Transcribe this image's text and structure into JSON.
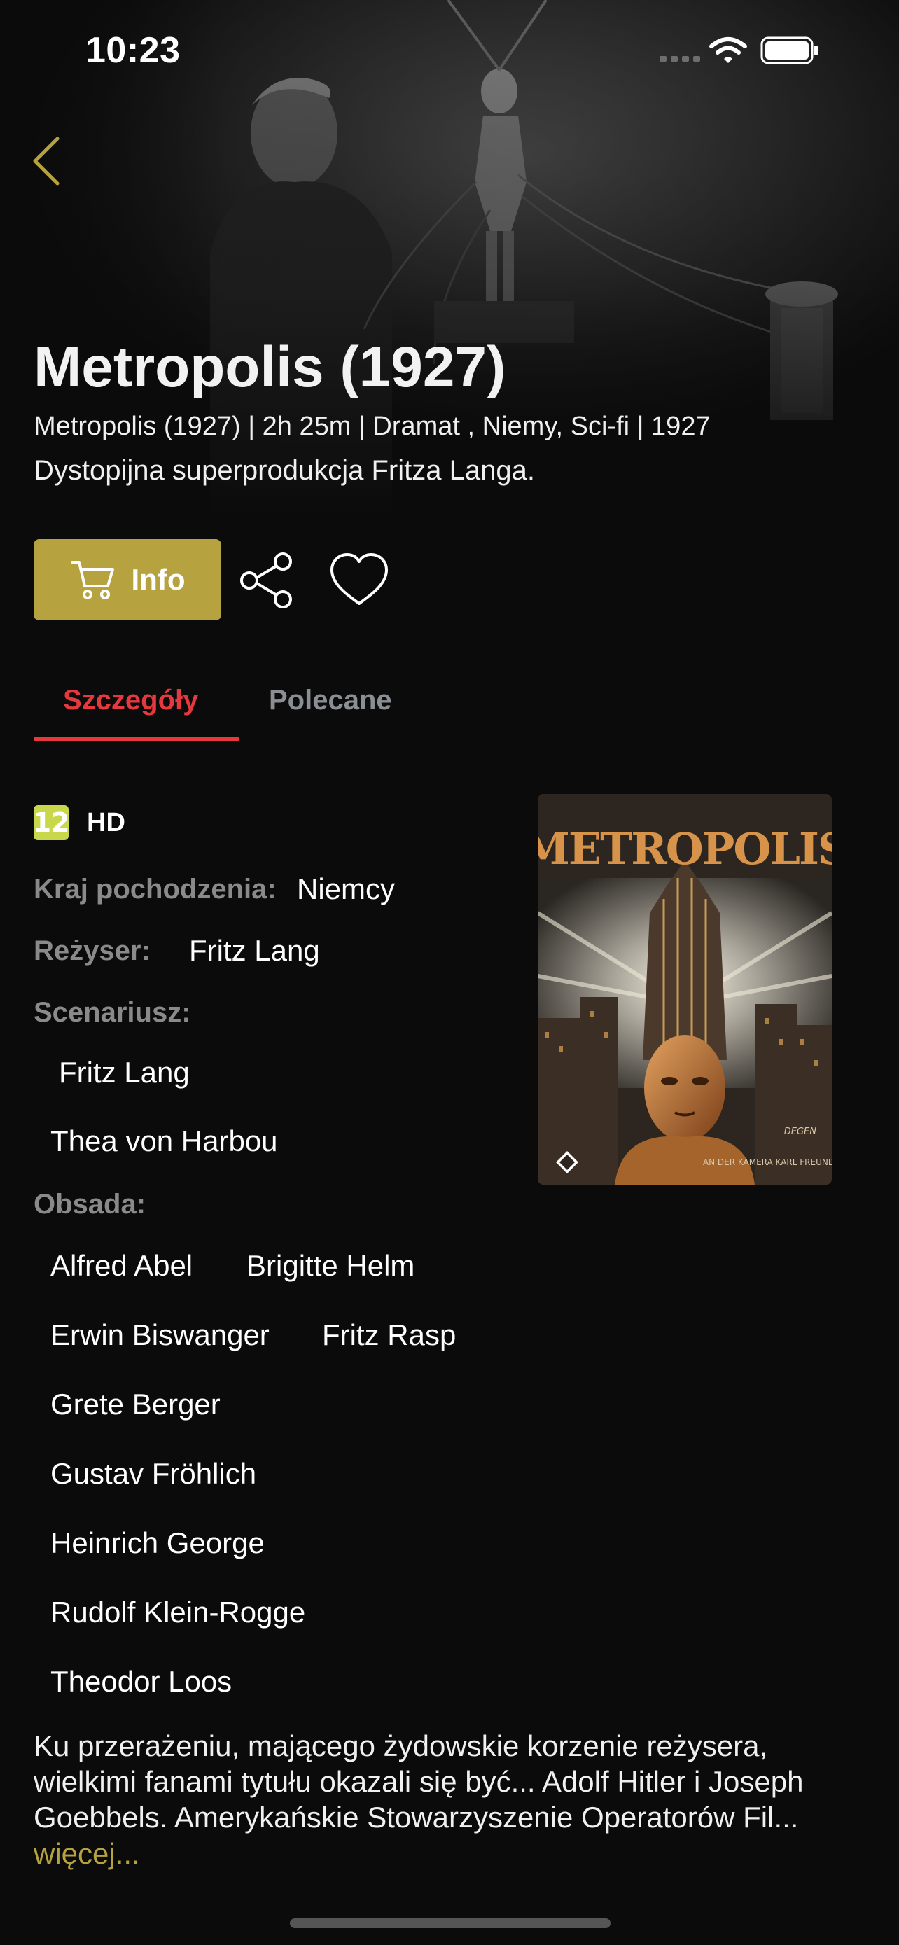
{
  "status_bar": {
    "time": "10:23"
  },
  "header": {
    "title": "Metropolis (1927)",
    "meta": "Metropolis (1927) | 2h 25m | Dramat , Niemy, Sci-fi | 1927",
    "description": "Dystopijna superprodukcja Fritza Langa."
  },
  "actions": {
    "info_label": "Info",
    "accent_color": "#b6a33f"
  },
  "tabs": [
    {
      "label": "Szczegóły",
      "active": true
    },
    {
      "label": "Polecane",
      "active": false
    }
  ],
  "details": {
    "age_rating": "12",
    "quality": "HD",
    "country_label": "Kraj pochodzenia:",
    "country_value": "Niemcy",
    "director_label": "Reżyser:",
    "director_value": "Fritz Lang",
    "writers_label": "Scenariusz:",
    "writers": [
      "Fritz Lang",
      "Thea von Harbou"
    ],
    "cast_label": "Obsada:",
    "cast": [
      "Alfred Abel",
      "Brigitte Helm",
      "Erwin Biswanger",
      "Fritz Rasp",
      "Grete Berger",
      "Gustav Fröhlich",
      "Heinrich George",
      "Rudolf Klein-Rogge",
      "Theodor Loos"
    ]
  },
  "poster": {
    "title_art": "METROPOLIS",
    "credit": "AN DER KAMERA KARL FREUND",
    "signature": "DEGEN"
  },
  "synopsis": {
    "text": "Ku przerażeniu, mającego żydowskie korzenie reżysera, wielkimi fanami tytułu okazali się być... Adolf Hitler i Joseph Goebbels. Amerykańskie Stowarzyszenie Operatorów Fil...",
    "more_label": "więcej..."
  },
  "colors": {
    "background": "#0b0b0b",
    "active_tab": "#e5393e",
    "inactive_tab": "#8b8f94",
    "label_gray": "#8a8a8a",
    "age_badge": "#c8d84a"
  },
  "icons": [
    "back-chevron-icon",
    "cart-icon",
    "share-icon",
    "heart-icon",
    "wifi-icon",
    "battery-icon",
    "signal-icon"
  ]
}
